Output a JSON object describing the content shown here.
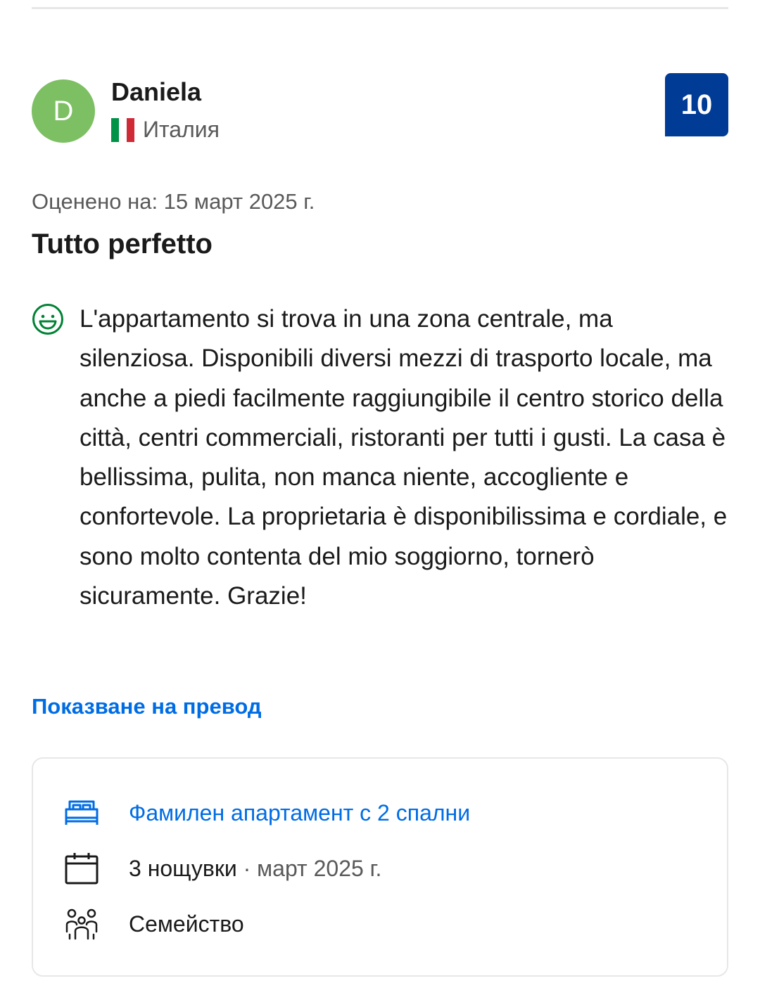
{
  "reviewer": {
    "avatar_initial": "D",
    "name": "Daniela",
    "country": "Италия",
    "flag_icon": "italy-flag-icon"
  },
  "score": "10",
  "review": {
    "date": "Оценено на: 15 март 2025 г.",
    "title": "Tutto perfetto",
    "positive_icon": "smiley-face-icon",
    "positive_text": "L'appartamento si trova in una zona centrale, ma silenziosa. Disponibili diversi mezzi di trasporto locale, ma anche a piedi facilmente raggiungibile il centro storico della città, centri commerciali, ristoranti per tutti i gusti. La casa è bellissima, pulita, non manca niente, accogliente e confortevole. La proprietaria è disponibilissima e cordiale, e sono molto contenta del mio soggiorno, tornerò sicuramente. Grazie!",
    "translate_link": "Показване на превод"
  },
  "stay": {
    "room": "Фамилен апартамент с 2 спални",
    "nights": "3 нощувки",
    "separator": "·",
    "month": "март 2025 г.",
    "traveler_type": "Семейство",
    "icons": [
      "bed-icon",
      "calendar-icon",
      "group-icon"
    ]
  },
  "colors": {
    "avatar_bg": "#7dbf63",
    "score_bg": "#003b95",
    "link": "#006ce4",
    "positive_icon": "#008234",
    "muted_text": "#595959"
  }
}
